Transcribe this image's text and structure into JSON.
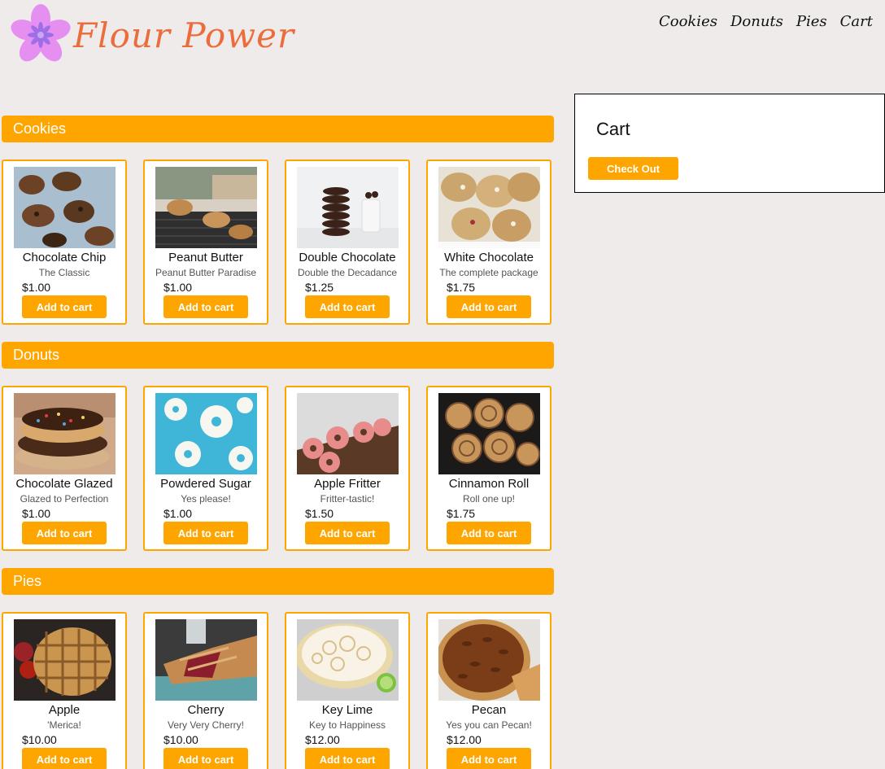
{
  "brand": {
    "name": "Flour Power",
    "accent": "#ffa500",
    "logo_color": "#ec6d3c",
    "flower_color": "#e58ff0"
  },
  "nav": [
    "Cookies",
    "Donuts",
    "Pies",
    "Cart"
  ],
  "sections": [
    {
      "title": "Cookies",
      "items": [
        {
          "name": "Chocolate Chip",
          "desc": "The Classic",
          "price": "$1.00",
          "button": "Add to cart"
        },
        {
          "name": "Peanut Butter",
          "desc": "Peanut Butter Paradise",
          "price": "$1.00",
          "button": "Add to cart"
        },
        {
          "name": "Double Chocolate",
          "desc": "Double the Decadance",
          "price": "$1.25",
          "button": "Add to cart"
        },
        {
          "name": "White Chocolate",
          "desc": "The complete package",
          "price": "$1.75",
          "button": "Add to cart"
        }
      ]
    },
    {
      "title": "Donuts",
      "items": [
        {
          "name": "Chocolate Glazed",
          "desc": "Glazed to Perfection",
          "price": "$1.00",
          "button": "Add to cart"
        },
        {
          "name": "Powdered Sugar",
          "desc": "Yes please!",
          "price": "$1.00",
          "button": "Add to cart"
        },
        {
          "name": "Apple Fritter",
          "desc": "Fritter-tastic!",
          "price": "$1.50",
          "button": "Add to cart"
        },
        {
          "name": "Cinnamon Roll",
          "desc": "Roll one up!",
          "price": "$1.75",
          "button": "Add to cart"
        }
      ]
    },
    {
      "title": "Pies",
      "items": [
        {
          "name": "Apple",
          "desc": "'Merica!",
          "price": "$10.00",
          "button": "Add to cart"
        },
        {
          "name": "Cherry",
          "desc": "Very Very Cherry!",
          "price": "$10.00",
          "button": "Add to cart"
        },
        {
          "name": "Key Lime",
          "desc": "Key to Happiness",
          "price": "$12.00",
          "button": "Add to cart"
        },
        {
          "name": "Pecan",
          "desc": "Yes you can Pecan!",
          "price": "$12.00",
          "button": "Add to cart"
        }
      ]
    }
  ],
  "cart": {
    "title": "Cart",
    "checkout_label": "Check Out"
  }
}
